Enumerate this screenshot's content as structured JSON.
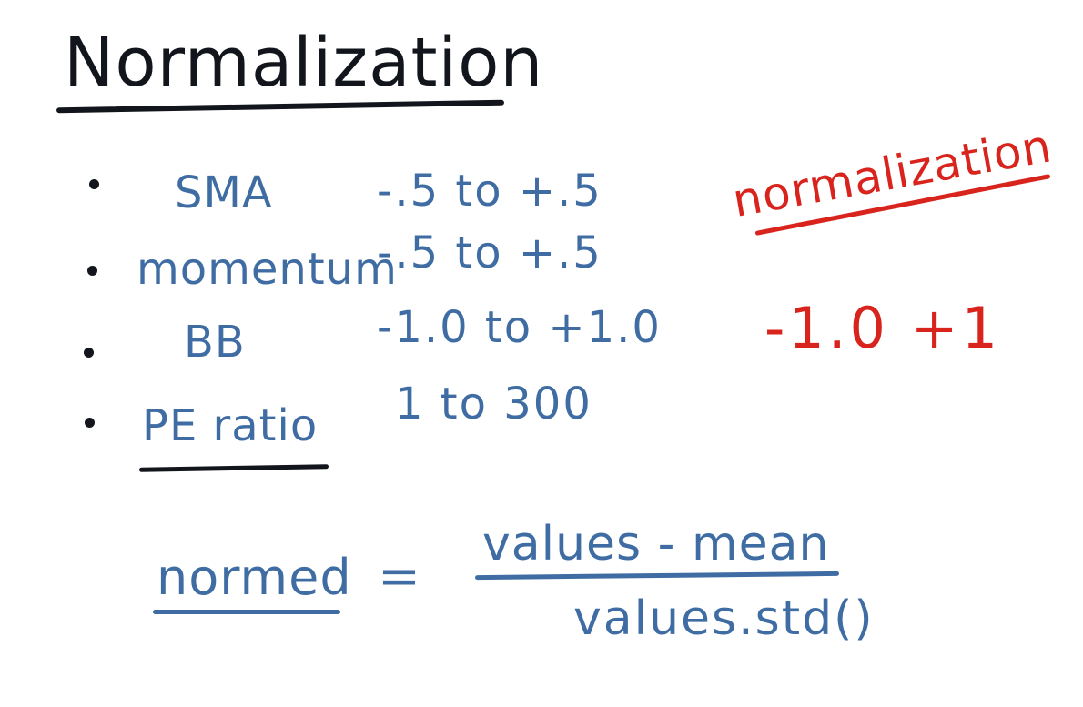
{
  "title": "Normalization",
  "rows": [
    {
      "label": "SMA",
      "range": "-.5 to +.5"
    },
    {
      "label": "momentum",
      "range": "-.5 to +.5"
    },
    {
      "label": "BB",
      "range": "-1.0 to +1.0"
    },
    {
      "label": "PE ratio",
      "range": "1 to 300"
    }
  ],
  "annotation": {
    "word": "normalization",
    "range": "-1.0 +1"
  },
  "formula": {
    "lhs": "normed",
    "equals": "=",
    "numerator": "values - mean",
    "denominator": "values.std()"
  },
  "colors": {
    "ink_black": "#12161c",
    "ink_blue": "#3f6da3",
    "ink_red": "#d8241c"
  }
}
